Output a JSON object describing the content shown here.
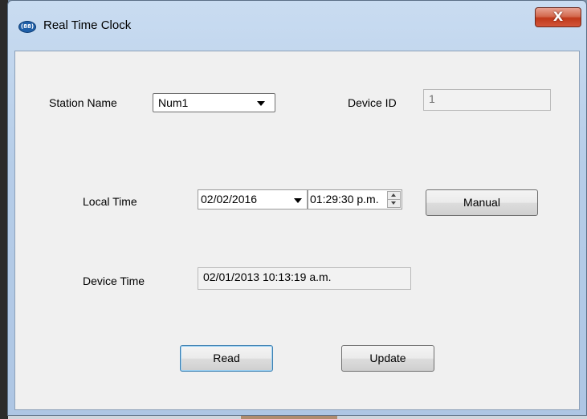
{
  "window": {
    "title": "Real Time Clock",
    "close_glyph": "X",
    "app_icon_text": "(88)"
  },
  "form": {
    "station_name_label": "Station Name",
    "station_name_value": "Num1",
    "device_id_label": "Device ID",
    "device_id_value": "1",
    "local_time_label": "Local Time",
    "local_date_value": "02/02/2016",
    "local_time_value": "01:29:30 p.m.",
    "manual_button": "Manual",
    "device_time_label": "Device Time",
    "device_time_value": "02/01/2013 10:13:19 a.m.",
    "read_button": "Read",
    "update_button": "Update"
  },
  "colors": {
    "title_gradient": "#c9dcf1",
    "close_button": "#c0391b",
    "client_bg": "#f0f0f0"
  },
  "icons": [
    "app-icon",
    "close-icon",
    "dropdown-arrow-icon",
    "spin-up-icon",
    "spin-down-icon"
  ]
}
